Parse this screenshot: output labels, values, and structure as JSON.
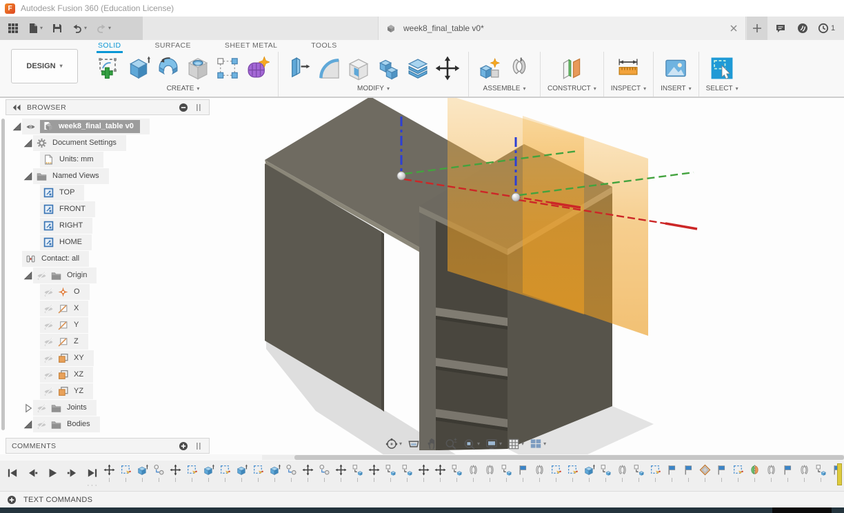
{
  "window": {
    "app_title": "Autodesk Fusion 360 (Education License)"
  },
  "toolbar": {
    "quick_access": [
      {
        "icon": "app-grid",
        "name": "app-launcher-button",
        "caret": false
      },
      {
        "icon": "file",
        "name": "file-menu-button",
        "caret": true
      },
      {
        "icon": "save",
        "name": "save-button",
        "caret": false
      },
      {
        "icon": "undo",
        "name": "undo-button",
        "caret": true
      },
      {
        "icon": "redo",
        "name": "redo-button",
        "caret": true
      }
    ],
    "document_tab": {
      "title": "week8_final_table v0*"
    },
    "right_buttons": [
      {
        "icon": "chat",
        "name": "comments-button"
      },
      {
        "icon": "status-swoosh",
        "name": "job-status-button"
      },
      {
        "icon": "clock",
        "name": "notifications-button"
      }
    ],
    "notification_count": "1"
  },
  "ribbon": {
    "workspace_label": "DESIGN",
    "tabs": [
      {
        "label": "SOLID",
        "active": true
      },
      {
        "label": "SURFACE",
        "active": false
      },
      {
        "label": "SHEET METAL",
        "active": false
      },
      {
        "label": "TOOLS",
        "active": false
      }
    ],
    "groups": [
      {
        "label": "CREATE",
        "tools": [
          {
            "icon": "create-sketch",
            "name": "create-sketch"
          },
          {
            "icon": "extrude",
            "name": "extrude"
          },
          {
            "icon": "revolve",
            "name": "revolve"
          },
          {
            "icon": "hole",
            "name": "hole"
          },
          {
            "icon": "pattern",
            "name": "rectangular-pattern"
          },
          {
            "icon": "form",
            "name": "create-form"
          }
        ]
      },
      {
        "label": "MODIFY",
        "tools": [
          {
            "icon": "press-pull",
            "name": "press-pull"
          },
          {
            "icon": "fillet",
            "name": "fillet"
          },
          {
            "icon": "shell",
            "name": "shell"
          },
          {
            "icon": "combine",
            "name": "combine"
          },
          {
            "icon": "split",
            "name": "split-body"
          },
          {
            "icon": "move-big",
            "name": "move-copy"
          }
        ]
      },
      {
        "label": "ASSEMBLE",
        "tools": [
          {
            "icon": "new-component",
            "name": "new-component"
          },
          {
            "icon": "joint-big",
            "name": "joint"
          }
        ]
      },
      {
        "label": "CONSTRUCT",
        "tools": [
          {
            "icon": "construct-plane",
            "name": "offset-plane"
          }
        ]
      },
      {
        "label": "INSPECT",
        "tools": [
          {
            "icon": "measure",
            "name": "measure"
          }
        ]
      },
      {
        "label": "INSERT",
        "tools": [
          {
            "icon": "insert-image",
            "name": "canvas-insert"
          }
        ]
      },
      {
        "label": "SELECT",
        "tools": [
          {
            "icon": "select",
            "name": "select-tool"
          }
        ]
      }
    ]
  },
  "browser": {
    "header_label": "BROWSER",
    "comments_label": "COMMENTS",
    "tree": [
      {
        "label": "week8_final_table v0",
        "level": 0,
        "icons": [
          "tri-open",
          "eye",
          "cube-doc"
        ],
        "selected": true
      },
      {
        "label": "Document Settings",
        "level": 1,
        "icons": [
          "tri-open",
          "gear"
        ],
        "selected": false
      },
      {
        "label": "Units: mm",
        "level": 2,
        "icons": [
          "doc-units"
        ],
        "selected": false
      },
      {
        "label": "Named Views",
        "level": 1,
        "icons": [
          "tri-open",
          "folder"
        ],
        "selected": false
      },
      {
        "label": "TOP",
        "level": 2,
        "icons": [
          "viewcube"
        ],
        "selected": false
      },
      {
        "label": "FRONT",
        "level": 2,
        "icons": [
          "viewcube"
        ],
        "selected": false
      },
      {
        "label": "RIGHT",
        "level": 2,
        "icons": [
          "viewcube"
        ],
        "selected": false
      },
      {
        "label": "HOME",
        "level": 2,
        "icons": [
          "viewcube"
        ],
        "selected": false
      },
      {
        "label": "Contact: all",
        "level": 1,
        "icons": [
          "contact"
        ],
        "selected": false
      },
      {
        "label": "Origin",
        "level": 1,
        "icons": [
          "tri-open",
          "eye-off",
          "folder"
        ],
        "selected": false
      },
      {
        "label": "O",
        "level": 2,
        "icons": [
          "eye-off",
          "origin-point"
        ],
        "selected": false
      },
      {
        "label": "X",
        "level": 2,
        "icons": [
          "eye-off",
          "axis"
        ],
        "selected": false
      },
      {
        "label": "Y",
        "level": 2,
        "icons": [
          "eye-off",
          "axis"
        ],
        "selected": false
      },
      {
        "label": "Z",
        "level": 2,
        "icons": [
          "eye-off",
          "axis"
        ],
        "selected": false
      },
      {
        "label": "XY",
        "level": 2,
        "icons": [
          "eye-off",
          "plane-sq"
        ],
        "selected": false
      },
      {
        "label": "XZ",
        "level": 2,
        "icons": [
          "eye-off",
          "plane-sq"
        ],
        "selected": false
      },
      {
        "label": "YZ",
        "level": 2,
        "icons": [
          "eye-off",
          "plane-sq"
        ],
        "selected": false
      },
      {
        "label": "Joints",
        "level": 1,
        "icons": [
          "tri-closed",
          "eye-off",
          "folder"
        ],
        "selected": false
      },
      {
        "label": "Bodies",
        "level": 1,
        "icons": [
          "tri-open",
          "eye-off",
          "folder"
        ],
        "selected": false
      }
    ]
  },
  "viewport": {
    "nav_buttons": [
      {
        "icon": "orbit",
        "name": "orbit",
        "caret": true
      },
      {
        "icon": "look-at",
        "name": "look-at",
        "caret": false
      },
      {
        "icon": "pan",
        "name": "pan",
        "caret": false
      },
      {
        "icon": "zoom",
        "name": "zoom",
        "caret": false
      },
      {
        "icon": "fit",
        "name": "fit",
        "caret": true
      },
      {
        "icon": "display",
        "name": "display-settings",
        "caret": true
      },
      {
        "icon": "grid-display",
        "name": "grid-and-snaps",
        "caret": true
      },
      {
        "icon": "viewports",
        "name": "viewports",
        "caret": true
      }
    ]
  },
  "timeline": {
    "playback": [
      {
        "icon": "pb-start",
        "name": "go-to-beginning"
      },
      {
        "icon": "pb-back",
        "name": "step-back"
      },
      {
        "icon": "pb-play",
        "name": "play"
      },
      {
        "icon": "pb-fwd",
        "name": "step-forward"
      },
      {
        "icon": "pb-end",
        "name": "go-to-end"
      }
    ],
    "features": [
      "move",
      "sketch",
      "extrude",
      "component",
      "move",
      "sketch",
      "extrude",
      "sketch",
      "extrude",
      "sketch",
      "extrude",
      "component",
      "move",
      "component",
      "move",
      "component-copy",
      "move",
      "component-copy",
      "component-copy",
      "move",
      "move",
      "component-copy",
      "joint",
      "joint",
      "component-copy",
      "plane-flag",
      "joint",
      "sketch",
      "sketch",
      "extrude",
      "component-copy",
      "joint",
      "component-copy",
      "sketch",
      "plane-flag",
      "plane-flag",
      "construction-plane",
      "plane-flag",
      "sketch",
      "mirror",
      "joint",
      "plane-flag",
      "joint",
      "component-copy",
      "plane-flag"
    ]
  },
  "status_bar": {
    "label": "TEXT COMMANDS"
  },
  "colors": {
    "accent_blue": "#0a97d5",
    "selection_gray": "#9c9c9c",
    "construction_plane_orange": "#f0a227",
    "joint_z_axis_blue": "#2d3fd4",
    "joint_x_axis_red": "#cc2727",
    "joint_y_axis_green": "#43a33e",
    "timeline_marker_yellow": "#decb3d"
  }
}
